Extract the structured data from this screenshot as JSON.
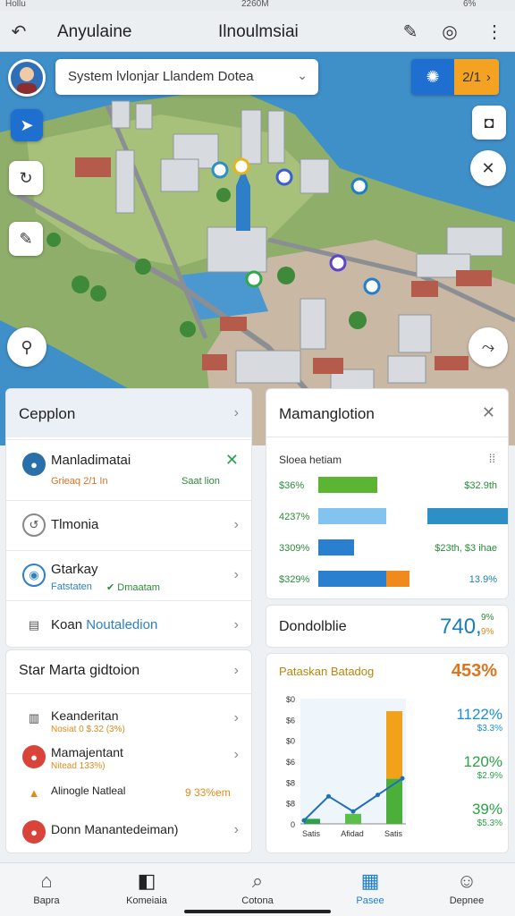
{
  "status": {
    "carrier": "Hollu",
    "time": "2260M",
    "battery": "6%"
  },
  "header": {
    "left_title": "Anyulaine",
    "center_title": "Ilnoulmsiai"
  },
  "map": {
    "search_text": "System lvlonjar Llandem Dotea",
    "badge_value": "2/1"
  },
  "left_panel": {
    "title": "Cepplon",
    "items": [
      {
        "label": "Manladimatai",
        "sub_left": "Grieaq 2/1 In",
        "sub_right": "Saat lion"
      },
      {
        "label": "Tlmonia"
      },
      {
        "label": "Gtarkay",
        "sub_left": "Fatstaten",
        "sub_right": "Dmaatam"
      },
      {
        "label": "Koan",
        "label_accent": "Noutaledion"
      }
    ]
  },
  "left_panel2": {
    "title": "Star Marta gidtoion",
    "items": [
      {
        "label": "Keanderitan",
        "sub": "Nosiat 0 $.32 (3%)"
      },
      {
        "label": "Mamajentant",
        "sub": "Nitead 133%)"
      },
      {
        "label": "Alinogle Natleal",
        "value": "9 33%em"
      },
      {
        "label": "Donn Manantedeiman)"
      }
    ]
  },
  "right_panel": {
    "title": "Mamanglotion",
    "sub_title": "Sloea hetiam",
    "chart_data": {
      "type": "bar",
      "rows": [
        {
          "left_label": "$36%",
          "right_label": "$32.9th",
          "values": [
            0.33,
            0
          ],
          "colors": [
            "#5bb432"
          ]
        },
        {
          "left_label": "4237%",
          "right_label": "",
          "values": [
            0.38,
            0.45
          ],
          "colors": [
            "#82c4ef",
            "#2d8fc4"
          ]
        },
        {
          "left_label": "3309%",
          "right_label": "$23th, $3 ihae",
          "values": [
            0.2,
            0
          ],
          "colors": [
            "#2a7fcf"
          ]
        },
        {
          "left_label": "$329%",
          "right_label": "13.9%",
          "values": [
            0.38,
            0.13
          ],
          "colors": [
            "#2a7fcf",
            "#f08a1c"
          ]
        }
      ]
    }
  },
  "right_panel2": {
    "title": "Dondolblie",
    "value": "740,",
    "pct": "9%",
    "pct2": "9%"
  },
  "right_panel3": {
    "title": "Pataskan Batadog",
    "headline": "453%",
    "chart_data": {
      "type": "bar",
      "y_ticks": [
        "$0",
        "$6",
        "$0",
        "$6",
        "$8",
        "$8",
        "0"
      ],
      "x_labels": [
        "Satis",
        "Afidad",
        "Satis"
      ],
      "bars": [
        0.04,
        0.08,
        0.9
      ],
      "line": [
        0.05,
        0.4,
        0.18,
        0.42,
        0.66
      ],
      "right_values": [
        {
          "v": "1122%",
          "s": "$3.3%",
          "color": "#1a8fcf"
        },
        {
          "v": "120%",
          "s": "$2.9%",
          "color": "#2da04a"
        },
        {
          "v": "39%",
          "s": "$5.3%",
          "color": "#2da04a"
        }
      ]
    }
  },
  "nav": {
    "items": [
      {
        "label": "Bapra",
        "icon": "home-icon"
      },
      {
        "label": "Komeiaia",
        "icon": "map-icon"
      },
      {
        "label": "Cotona",
        "icon": "search-icon"
      },
      {
        "label": "Pasee",
        "icon": "calendar-icon",
        "active": true
      },
      {
        "label": "Depnee",
        "icon": "user-icon"
      }
    ]
  }
}
